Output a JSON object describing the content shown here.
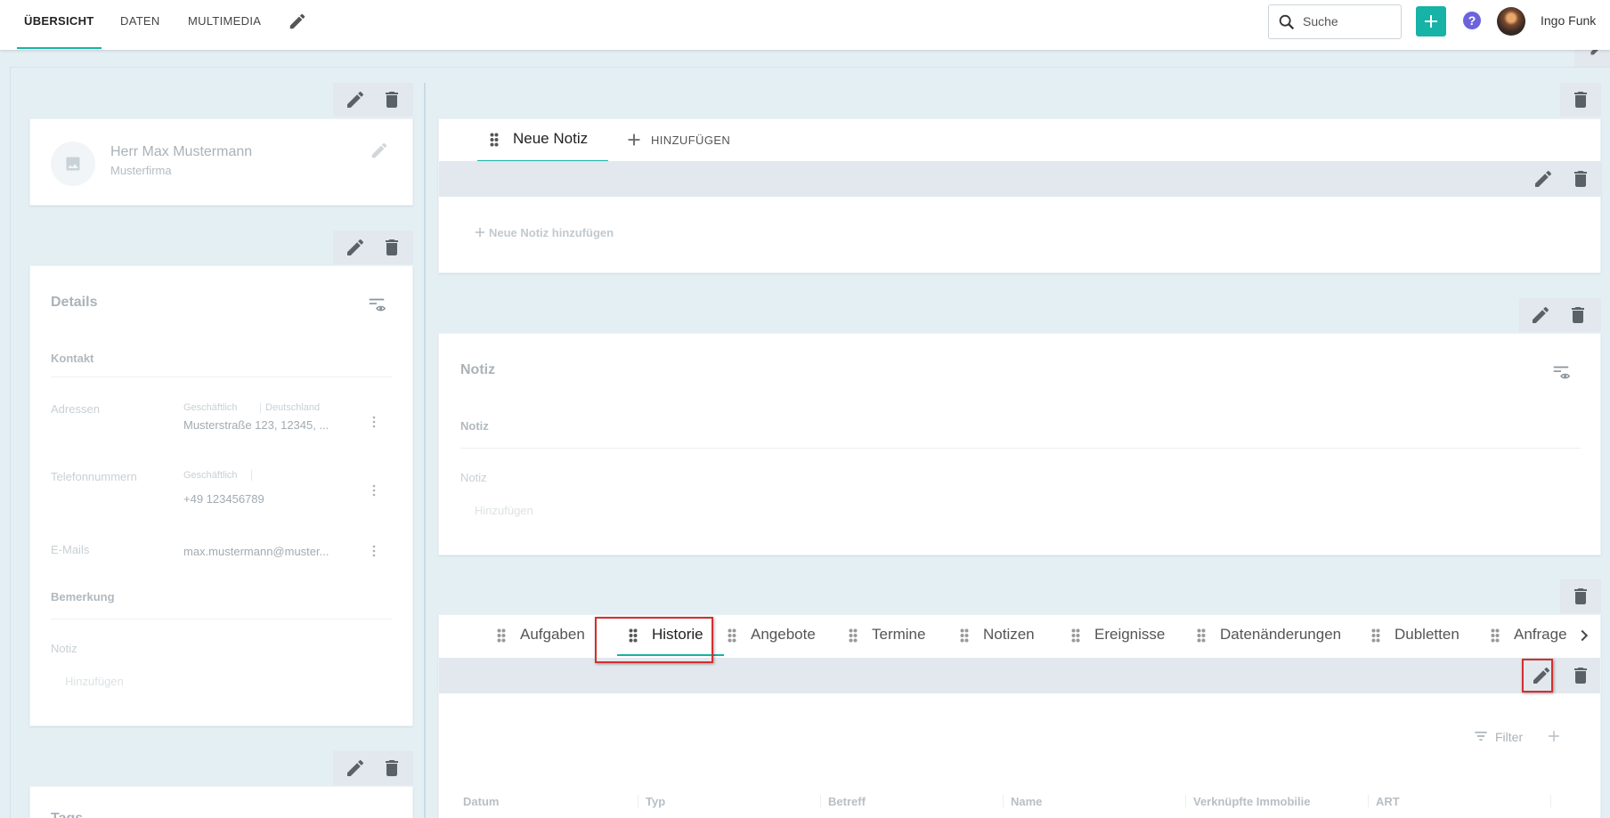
{
  "topbar": {
    "tabs": [
      {
        "label": "ÜBERSICHT",
        "active": true
      },
      {
        "label": "DATEN",
        "active": false
      },
      {
        "label": "MULTIMEDIA",
        "active": false
      }
    ],
    "search_placeholder": "Suche",
    "help_glyph": "?",
    "user_name": "Ingo Funk"
  },
  "profile": {
    "name": "Herr Max Mustermann",
    "company": "Musterfirma"
  },
  "details": {
    "title": "Details",
    "contact_heading": "Kontakt",
    "addresses_label": "Adressen",
    "address_type": "Geschäftlich",
    "address_country": "Deutschland",
    "address_value": "Musterstraße 123, 12345, ...",
    "phones_label": "Telefonnummern",
    "phone_type": "Geschäftlich",
    "phone_value": "+49 123456789",
    "emails_label": "E-Mails",
    "email_value": "max.mustermann@muster...",
    "remark_heading": "Bemerkung",
    "note_label": "Notiz",
    "add_placeholder": "Hinzufügen"
  },
  "tags_card": {
    "title": "Tags"
  },
  "note_tabs": {
    "tab_label": "Neue Notiz",
    "add_tab_label": "HINZUFÜGEN",
    "add_note_link": "Neue Notiz hinzufügen"
  },
  "notiz_card": {
    "title": "Notiz",
    "section_label": "Notiz",
    "field_label": "Notiz",
    "add_placeholder": "Hinzufügen"
  },
  "history_tabs": {
    "tabs": [
      "Aufgaben",
      "Historie",
      "Angebote",
      "Termine",
      "Notizen",
      "Ereignisse",
      "Datenänderungen",
      "Dubletten",
      "Anfrage"
    ],
    "active": "Historie"
  },
  "history_table": {
    "filter_label": "Filter",
    "columns": [
      "Datum",
      "Typ",
      "Betreff",
      "Name",
      "Verknüpfte Immobilie",
      "ART"
    ]
  },
  "colors": {
    "accent": "#16b3a6",
    "help": "#6c63dc",
    "highlight": "#d32f2f",
    "canvas": "#e4eff4",
    "toolbar": "#e2e8ed"
  },
  "icons": [
    "search-icon",
    "plus-icon",
    "help-icon",
    "pencil-icon",
    "trash-icon",
    "image-icon",
    "eye-filter-icon",
    "more-vert-icon",
    "drag-handle-icon",
    "chevron-right-icon",
    "filter-icon"
  ]
}
